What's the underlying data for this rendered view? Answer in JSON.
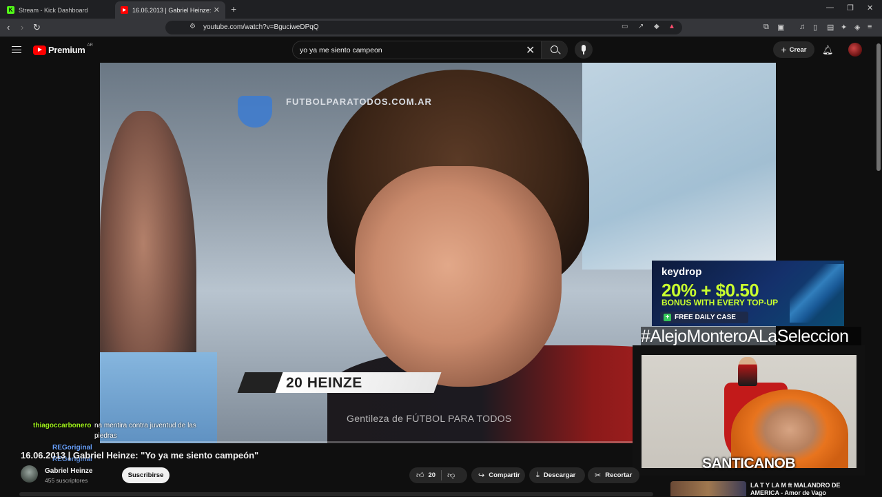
{
  "browser": {
    "tabs": [
      {
        "title": "Stream - Kick Dashboard",
        "favicon": "kick-icon"
      },
      {
        "title": "16.06.2013 | Gabriel Heinze: \"",
        "favicon": "youtube-icon",
        "active": true
      }
    ],
    "url": "youtube.com/watch?v=BguciweDPqQ"
  },
  "youtube": {
    "logo": "Premium",
    "country": "AR",
    "search_query": "yo ya me siento campeon",
    "create_label": "Crear"
  },
  "video": {
    "watermark_site": "FUTBOLPARATODOS.COM.AR",
    "lower_third": "20 HEINZE",
    "credit": "Gentileza de FÚTBOL PARA TODOS",
    "title": "16.06.2013 | Gabriel Heinze: \"Yo ya me siento campeón\"",
    "channel": "Gabriel Heinze",
    "subscribers": "455 suscriptores",
    "subscribe_label": "Suscribirse",
    "likes": "20",
    "actions": {
      "share": "Compartir",
      "download": "Descargar",
      "clip": "Recortar"
    }
  },
  "overlay": {
    "ad": {
      "brand": "keydrop",
      "headline": "20% + $0.50",
      "subline": "BONUS WITH EVERY TOP-UP",
      "cta": "FREE DAILY CASE"
    },
    "hashtag": "#AlejoMonteroALaSeleccion",
    "streamer_name": "SANTICANOB",
    "chat": [
      {
        "user": "thiagoccarbonero",
        "message": "na mentira contra juventud de las piedras"
      },
      {
        "user": "REGoriginal",
        "message": ""
      },
      {
        "user": "REGoriginal",
        "message": ""
      }
    ]
  },
  "upnext": {
    "title": "LA T Y LA M ft MALANDRO DE AMERICA - Amor de Vago"
  }
}
